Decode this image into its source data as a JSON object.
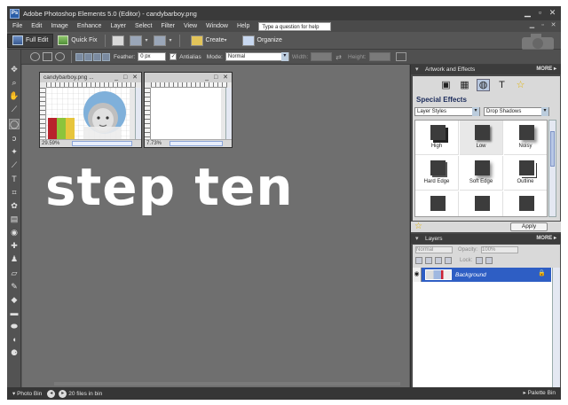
{
  "window": {
    "title": "Adobe Photoshop Elements 5.0 (Editor) - candybarboy.png"
  },
  "menu": {
    "items": [
      "File",
      "Edit",
      "Image",
      "Enhance",
      "Layer",
      "Select",
      "Filter",
      "View",
      "Window",
      "Help"
    ],
    "help_placeholder": "Type a question for help"
  },
  "shortcuts": {
    "full_edit": "Full Edit",
    "quick_fix": "Quick Fix",
    "create": "Create",
    "organize": "Organize"
  },
  "options": {
    "feather_label": "Feather:",
    "feather_value": "0 px",
    "antialias_label": "Antialias",
    "antialias_checked": "✓",
    "mode_label": "Mode:",
    "mode_value": "Normal",
    "width_label": "Width:",
    "height_label": "Height:"
  },
  "documents": [
    {
      "title": "candybarboy.png ...",
      "zoom": "29.59%"
    },
    {
      "title": "",
      "zoom": "7.73%"
    }
  ],
  "canvas_text": "step ten",
  "artwork_panel": {
    "header": "Artwork and Effects",
    "more": "MORE",
    "section_title": "Special Effects",
    "category": "Layer Styles",
    "style": "Drop Shadows",
    "effects": [
      "High",
      "Low",
      "Noisy",
      "Hard Edge",
      "Soft Edge",
      "Outline"
    ],
    "apply": "Apply"
  },
  "layers_panel": {
    "header": "Layers",
    "more": "MORE",
    "blend_mode": "Normal",
    "opacity_label": "Opacity:",
    "opacity_value": "100%",
    "lock_label": "Lock:",
    "layer_name": "Background"
  },
  "status": {
    "photo_bin": "Photo Bin",
    "files_in_bin": "20 files in bin",
    "palette_bin": "Palette Bin"
  },
  "colors": {
    "selected_layer": "#2e5ec4",
    "foreground": "#ffffff",
    "background": "#e0607a"
  }
}
